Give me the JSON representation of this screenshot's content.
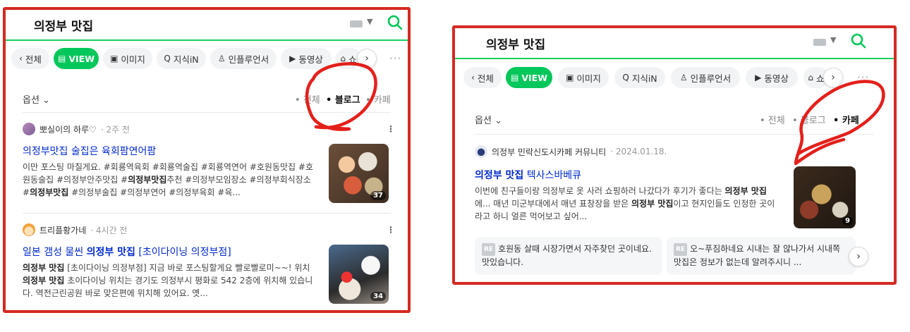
{
  "left": {
    "query": "의정부 맛집",
    "tabs": [
      {
        "label": "전체",
        "icon": "chevron-left-icon"
      },
      {
        "label": "VIEW",
        "icon": "document-icon"
      },
      {
        "label": "이미지",
        "icon": "image-icon"
      },
      {
        "label": "지식iN",
        "icon": "qna-icon"
      },
      {
        "label": "인플루언서",
        "icon": "person-icon"
      },
      {
        "label": "동영상",
        "icon": "play-icon"
      },
      {
        "label": "쇼",
        "icon": "bag-icon"
      }
    ],
    "filter": {
      "options": "옵션",
      "types": [
        "• 전체",
        "• 블로그",
        "• 카페"
      ],
      "selected": "• 블로그"
    },
    "posts": [
      {
        "author": "뽀실이의 하루♡",
        "time": "· 2주 전",
        "title": "의정부맛집 술집은 육회팜연어팜",
        "snippet_1": "이만 포스팅 마칠게요. #회룡역육회 #회룡역술집 #회룡역연어 #호원동맛집 #호원동술집 #의정부안주맛집 #",
        "snippet_b1": "의정부맛집",
        "snippet_2": "추천 #의정부모임장소 #의정부회식장소 #",
        "snippet_b2": "의정부맛집",
        "snippet_3": " #의정부술집 #의정부연어 #의정부육회 #육...",
        "thumb_count": "37"
      },
      {
        "author": "트리플황가네",
        "time": "· 4시간 전",
        "title_1": "일본 갬성 물씬 ",
        "title_b": "의정부 맛집",
        "title_2": " [초이다이닝 의정부점]",
        "snippet_b1": "의정부 맛집",
        "snippet_1": " [초이다이닝 의정부점] 지금 바로 포스팅할게요 빨로빨로미~~! 위치 ",
        "snippet_b2": "의정부 맛집",
        "snippet_2": " 초이다이닝 위치는 경기도 의정부시 평화로 542 2층에 위치해 있습니다. 역전근린공원 바로 맞은편에 위치해 있어요. 옛...",
        "thumb_count": "34"
      }
    ]
  },
  "right": {
    "query": "의정부 맛집",
    "tabs": [
      {
        "label": "전체",
        "icon": "chevron-left-icon"
      },
      {
        "label": "VIEW",
        "icon": "document-icon"
      },
      {
        "label": "이미지",
        "icon": "image-icon"
      },
      {
        "label": "지식iN",
        "icon": "qna-icon"
      },
      {
        "label": "인플루언서",
        "icon": "person-icon"
      },
      {
        "label": "동영상",
        "icon": "play-icon"
      },
      {
        "label": "쇼",
        "icon": "bag-icon"
      }
    ],
    "filter": {
      "options": "옵션",
      "types": [
        "• 전체",
        "• 블로그",
        "• 카페"
      ],
      "selected": "• 카페"
    },
    "post": {
      "author": "의정부 민락신도시카페 커뮤니티",
      "time": "· 2024.01.18.",
      "title_b": "의정부 맛집",
      "title_2": " 텍사스바베큐",
      "snippet_1": "이번에 친구들이랑 의정부로 옷 사러 쇼핑하러 나갔다가 후기가 좋다는 ",
      "snippet_b1": "의정부 맛집",
      "snippet_2": "에... 매년 미군부대에서 매년 표창장을 받은 ",
      "snippet_b2": "의정부 맛집",
      "snippet_3": "이고 현지인들도 인정한 곳이라고 하니 얼른 먹어보고 싶어...",
      "thumb_count": "9"
    },
    "comments": [
      {
        "badge": "RE",
        "text": "호원동 살때 시장가면서 자주찾던 곳이네요. 맛있습니다."
      },
      {
        "badge": "RE",
        "text": "오~푸짐하네요 시내는 잘 않나가서 시내쪽 맛집은 정보가 없는데 알려주시니 ..."
      }
    ]
  },
  "colors": {
    "accent_green": "#03c75a",
    "title_blue": "#0029cc",
    "annotation_red": "#e3201b"
  }
}
